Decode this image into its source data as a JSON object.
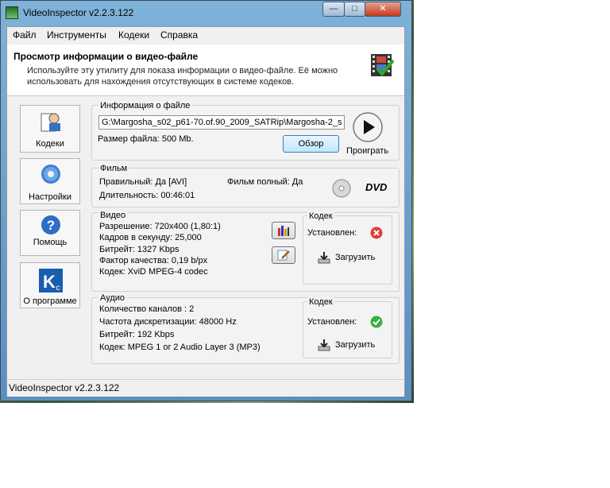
{
  "window": {
    "title": "VideoInspector v2.2.3.122",
    "buttons": {
      "minimize": "—",
      "maximize": "□",
      "close": "✕"
    }
  },
  "menu": [
    "Файл",
    "Инструменты",
    "Кодеки",
    "Справка"
  ],
  "header": {
    "title": "Просмотр информации о видео-файле",
    "description": "Используйте эту утилиту для показа информации о видео-файле. Её можно использовать для нахождения отсутствующих в системе кодеков."
  },
  "sidebar": [
    {
      "label": "Кодеки",
      "icon": "codecs-icon"
    },
    {
      "label": "Настройки",
      "icon": "gear-icon"
    },
    {
      "label": "Помощь",
      "icon": "help-icon"
    },
    {
      "label": "О программе",
      "icon": "about-icon"
    }
  ],
  "file_info": {
    "group_title": "Информация о файле",
    "path": "G:\\Margosha_s02_p61-70.of.90_2009_SATRip\\Margosha-2_s",
    "size_label": "Размер файла: 500 Mb.",
    "browse_label": "Обзор",
    "play_label": "Проиграть"
  },
  "film": {
    "group_title": "Фильм",
    "valid": "Правильный: Да [AVI]",
    "full": "Фильм полный: Да",
    "duration": "Длительность: 00:46:01",
    "dvd_logo": "DVD"
  },
  "video": {
    "group_title": "Видео",
    "lines": [
      "Разрешение: 720x400 (1,80:1)",
      "Кадров в секунду: 25,000",
      "Битрейт: 1327 Kbps",
      "Фактор качества: 0,19 b/px",
      "Кодек: XviD MPEG-4 codec"
    ],
    "codec_group_title": "Кодек",
    "installed_label": "Установлен:",
    "installed_status": "error",
    "download_label": "Загрузить"
  },
  "audio": {
    "group_title": "Аудио",
    "lines": [
      "Количество каналов : 2",
      "Частота дискретизации: 48000 Hz",
      "Битрейт: 192 Kbps",
      "Кодек: MPEG 1 or 2 Audio Layer 3 (MP3)"
    ],
    "codec_group_title": "Кодек",
    "installed_label": "Установлен:",
    "installed_status": "ok",
    "download_label": "Загрузить"
  },
  "status_bar": "VideoInspector v2.2.3.122",
  "colors": {
    "error_icon": "#e23b3b",
    "ok_icon": "#3cae3c",
    "accent_focus": "#3c7fb1"
  }
}
